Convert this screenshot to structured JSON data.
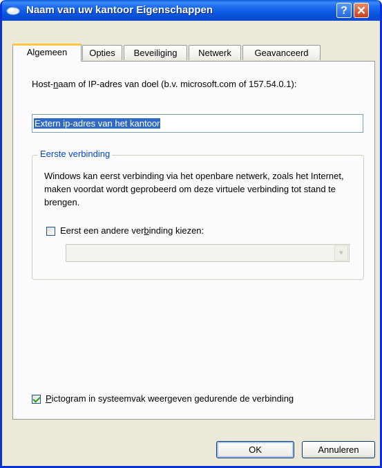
{
  "window": {
    "title": "Naam van uw kantoor Eigenschappen",
    "help_label": "?",
    "close_label": "✕"
  },
  "tabs": [
    {
      "label": "Algemeen",
      "active": true
    },
    {
      "label": "Opties",
      "active": false
    },
    {
      "label": "Beveiliging",
      "active": false
    },
    {
      "label": "Netwerk",
      "active": false
    },
    {
      "label": "Geavanceerd",
      "active": false
    }
  ],
  "general": {
    "host_label_pre": "Host-",
    "host_label_accel": "n",
    "host_label_post": "aam of IP-adres van doel (b.v. microsoft.com of 157.54.0.1):",
    "host_value": "Extern ip-adres van het kantoor",
    "group_title": "Eerste verbinding",
    "group_description": "Windows kan eerst verbinding via het openbare netwerk, zoals het Internet, maken voordat wordt geprobeerd om deze virtuele verbinding tot stand te brengen.",
    "first_connect_pre": "Eerst een andere ver",
    "first_connect_accel": "b",
    "first_connect_post": "inding kiezen:",
    "first_connect_checked": false,
    "combo_value": "",
    "tray_icon_pre": "",
    "tray_icon_accel": "P",
    "tray_icon_post": "ictogram in systeemvak weergeven gedurende de verbinding",
    "tray_icon_checked": true
  },
  "buttons": {
    "ok": "OK",
    "cancel": "Annuleren"
  }
}
